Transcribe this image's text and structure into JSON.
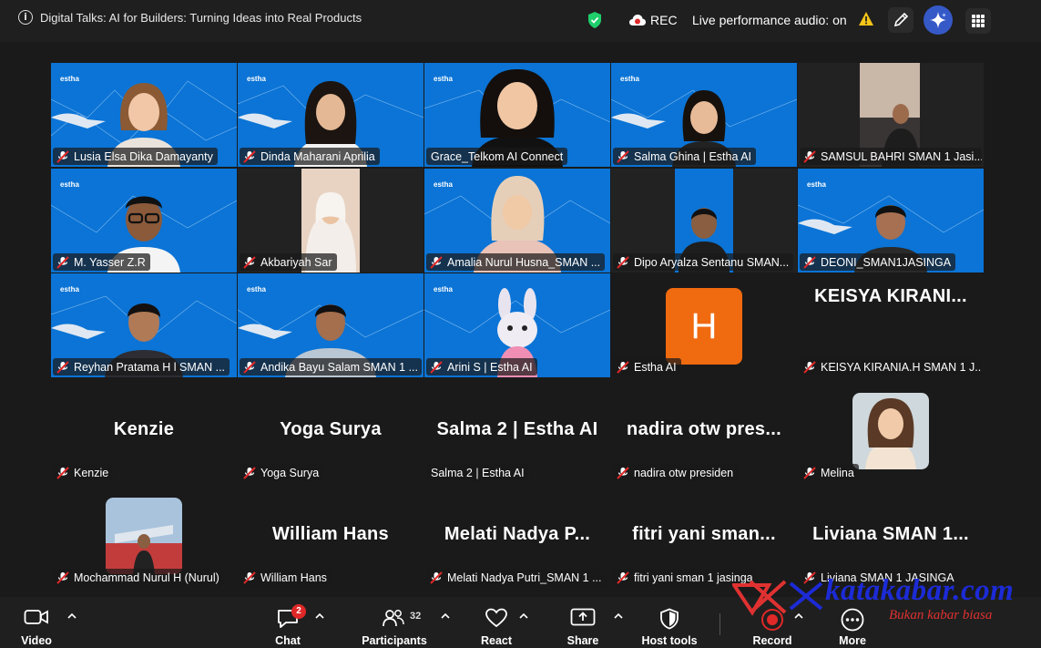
{
  "window": {
    "title": "Digital Talks: AI for Builders: Turning Ideas into Real Products",
    "rec_label": "REC",
    "audio_status": "Live performance audio: on",
    "colors": {
      "topbar": "#1f1f1f",
      "active_speaker": "#2fdc8f",
      "video_bg": "#0a72d0",
      "rec_red": "#e02828"
    }
  },
  "tiles": [
    {
      "name": "Lusia Elsa Dika Damayanty"
    },
    {
      "name": "Dinda Maharani Aprilia"
    },
    {
      "name": "Grace_Telkom AI Connect"
    },
    {
      "name": "Salma Ghina | Estha AI"
    },
    {
      "name": "SAMSUL BAHRI SMAN 1 Jasi..."
    },
    {
      "name": "M. Yasser Z.R"
    },
    {
      "name": "Akbariyah Sar"
    },
    {
      "name": "Amalia Nurul Husna_SMAN ..."
    },
    {
      "name": "Dipo Aryalza Sentanu SMAN..."
    },
    {
      "name": "DEONI_SMAN1JASINGA"
    },
    {
      "name": "Reyhan Pratama H  l SMAN ..."
    },
    {
      "name": "Andika Bayu Salam SMAN 1 ..."
    },
    {
      "name": "Arini S | Estha AI"
    },
    {
      "name": "Estha AI",
      "avatar_letter": "H"
    },
    {
      "name": "KEISYA KIRANIA.H SMAN 1 J...",
      "display": "KEISYA  KIRANI..."
    },
    {
      "name": "Kenzie",
      "display": "Kenzie"
    },
    {
      "name": "Yoga Surya",
      "display": "Yoga Surya"
    },
    {
      "name": "Salma 2 | Estha AI",
      "display": "Salma 2 | Estha AI"
    },
    {
      "name": "nadira otw presiden",
      "display": "nadira  otw  pres..."
    },
    {
      "name": "Melina"
    },
    {
      "name": "Mochammad Nurul H (Nurul)"
    },
    {
      "name": "William Hans",
      "display": "William Hans"
    },
    {
      "name": "Melati Nadya Putri_SMAN 1 ...",
      "display": "Melati  Nadya  P..."
    },
    {
      "name": "fitri yani sman 1 jasinga",
      "display": "fitri  yani  sman..."
    },
    {
      "name": "Liviana SMAN 1 JASINGA",
      "display": "Liviana  SMAN  1..."
    }
  ],
  "toolbar": {
    "video": "Video",
    "chat": "Chat",
    "chat_badge": "2",
    "participants": "Participants",
    "participants_count": "32",
    "react": "React",
    "share": "Share",
    "host_tools": "Host tools",
    "record": "Record",
    "more": "More"
  },
  "watermark": {
    "text": "katakabar.com",
    "tagline": "Bukan kabar biasa"
  }
}
